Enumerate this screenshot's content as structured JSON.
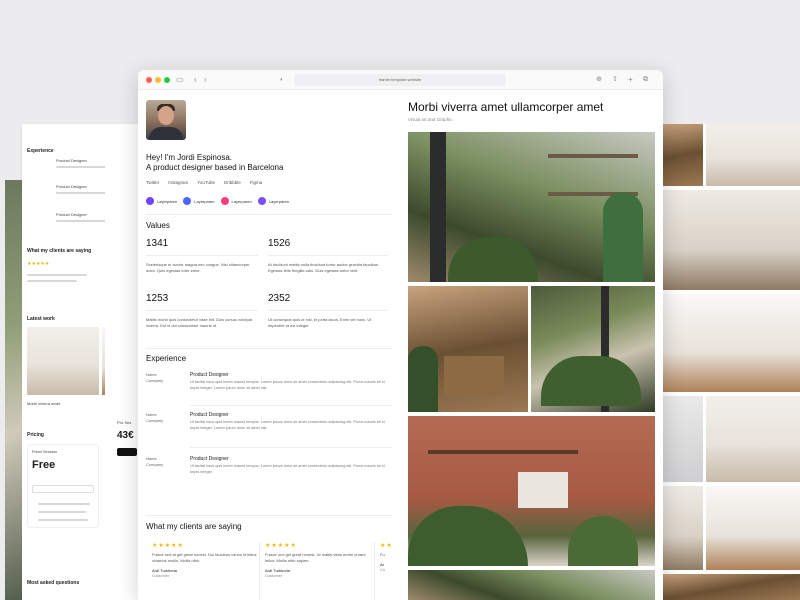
{
  "left_card": {
    "experience_title": "Experience",
    "rows": [
      "Product Designer",
      "Product Designer",
      "Product Designer"
    ],
    "clients_title": "What my clients are saying",
    "stars": "★★★★★",
    "latest_title": "Latest work",
    "latest_caption": "Morbi viverra amet",
    "pricing_title": "Pricing",
    "plan_name": "Fixed Session",
    "plan_price": "Free",
    "plan_price_2": "43€",
    "plan_name_2": "Pro Ses",
    "faq_title": "Most asked questions"
  },
  "browser": {
    "url": "framer.template.website",
    "colors": {
      "close": "#ff5f57",
      "min": "#febc2e",
      "max": "#28c840"
    }
  },
  "profile": {
    "greeting_line1": "Hey! I'm Jordi Espinosa.",
    "greeting_line2": "A product designer based in Barcelona",
    "socials": [
      "Twitter",
      "Instagram",
      "YouTube",
      "Dribbble",
      "Figma"
    ],
    "pills": [
      {
        "label": "Layerparen",
        "color": "#6c47ff"
      },
      {
        "label": "Layerparen",
        "color": "#4a67ff"
      },
      {
        "label": "Layerparen",
        "color": "#ff3b7f"
      },
      {
        "label": "Layerparen",
        "color": "#7b4dff"
      }
    ]
  },
  "values": {
    "title": "Values",
    "items": [
      {
        "number": "1341",
        "text": "Scelerisque et auctor magna nec congue. Nisi ullamcorper dolor. Quis egestas torer enim."
      },
      {
        "number": "1526",
        "text": "At tincidunt mattis nulla tincidunt tortor auctor gravida faucibus. Egestas felis fringilla odio. Duis egestas tortor velit."
      },
      {
        "number": "1253",
        "text": "Mattis morbi quis consectetur vitae elit. Duis cursus volutpat viverra. Est in dui consectetur mauris ut."
      },
      {
        "number": "2352",
        "text": "Ut consequat quis ut nisl, In porta lacus. Enim vel nunc. Ut imperdiet et est integer."
      }
    ]
  },
  "experience": {
    "title": "Experience",
    "items": [
      {
        "company": "Name\nCompany",
        "role": "Product Designer",
        "text": "Ut facilisi risus quis lorem mauris tempus. Lorem ipsum dolor sit amet consectetur adipiscing elit. Purus mauris sit id turpis integer. Lorem ipsum dolor sit amet nisl."
      },
      {
        "company": "Name\nCompany",
        "role": "Product Designer",
        "text": "Ut facilisi risus quis lorem mauris tempus. Lorem ipsum dolor sit amet consectetur adipiscing elit. Purus mauris sit id turpis integer. Lorem ipsum dolor sit amet nisl."
      },
      {
        "company": "Name\nCompany",
        "role": "Product Designer",
        "text": "Ut facilisi risus quis lorem mauris tempus. Lorem ipsum dolor sit amet consectetur adipiscing elit. Purus mauris sit id turpis integer."
      }
    ]
  },
  "clients": {
    "title": "What my clients are saying",
    "items": [
      {
        "stars": "★★★★★",
        "text": "Fuisce sed at get great honest. Dui faucibus varius id tellus vivamus mollis. Mollis nibh.",
        "name": "Ardi Turkhoria",
        "role": "Customer"
      },
      {
        "stars": "★★★★★",
        "text": "Fuisce orci get great honest. Ut mattis vitae morbi ornare tellus. Mollis nibh sapien.",
        "name": "Ardi Turkhoria",
        "role": "Customer"
      },
      {
        "stars": "★★",
        "text": "Fu",
        "name": "Ar",
        "role": "Cu"
      }
    ]
  },
  "project": {
    "title": "Morbi viverra amet ullamcorper amet",
    "subtitle": "Visual art and Graphic"
  }
}
